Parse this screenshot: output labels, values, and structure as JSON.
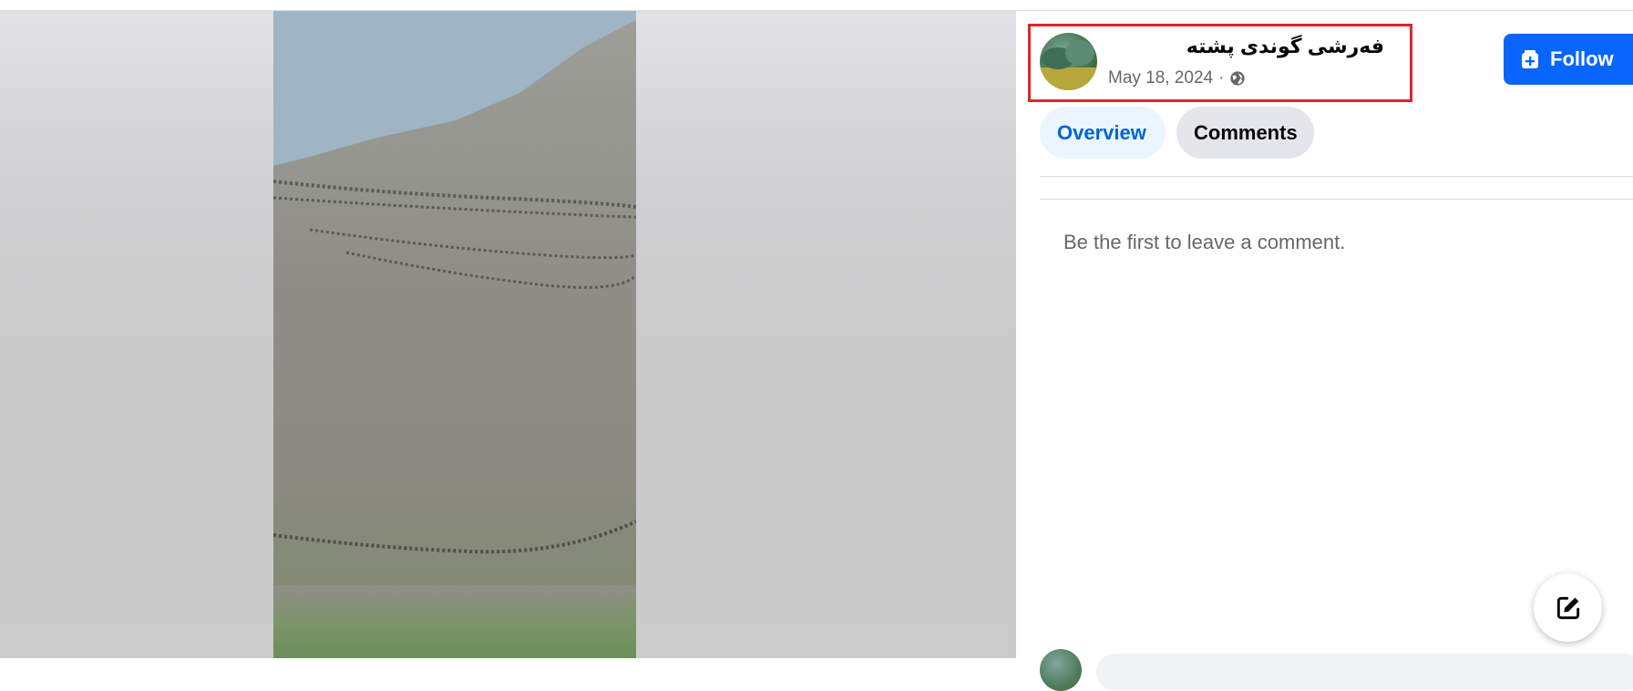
{
  "post": {
    "page_name": "فەرشی گوندی پشتە",
    "date": "May 18, 2024",
    "separator": "·",
    "privacy_icon": "globe-icon"
  },
  "actions": {
    "follow_label": "Follow",
    "follow_icon": "follow-page-icon"
  },
  "tabs": [
    {
      "label": "Overview",
      "active": true
    },
    {
      "label": "Comments",
      "active": false
    }
  ],
  "comments": {
    "empty_message": "Be the first to leave a comment."
  },
  "compose": {
    "icon": "edit-icon"
  },
  "colors": {
    "accent": "#0866ff",
    "highlight_box": "#e0242d",
    "tab_active_bg": "#ebf5ff",
    "tab_active_text": "#0064d1"
  }
}
